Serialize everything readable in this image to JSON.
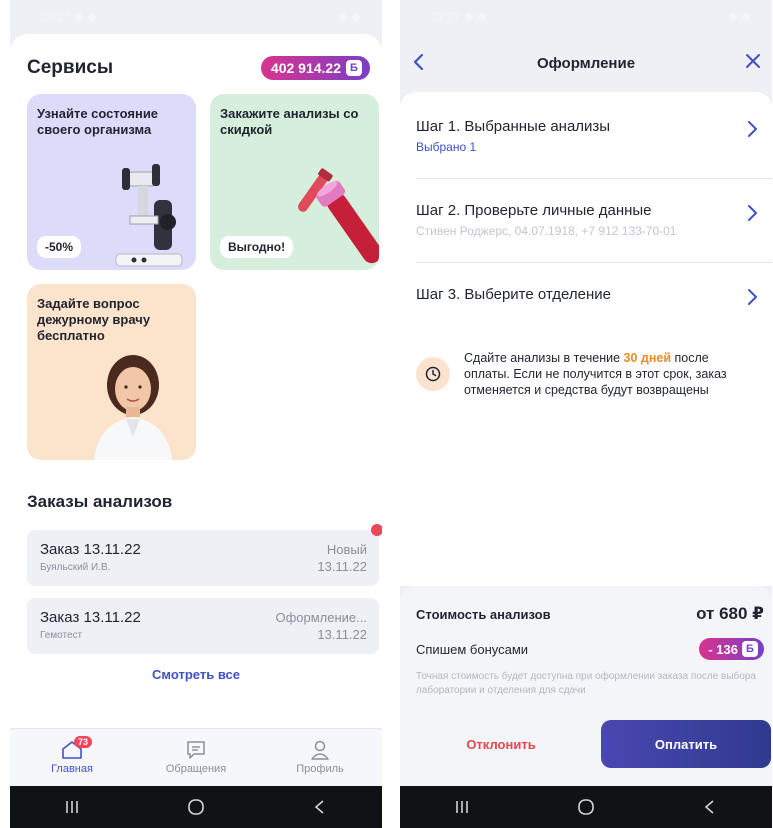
{
  "left": {
    "status": {
      "time": "23:27"
    },
    "services": {
      "title": "Сервисы",
      "bonus_balance": "402 914.22",
      "bonus_symbol": "Б"
    },
    "cards": [
      {
        "title": "Узнайте состояние своего организма",
        "badge": "-50%"
      },
      {
        "title": "Закажите анализы со скидкой",
        "badge": "Выгодно!"
      },
      {
        "title": "Задайте вопрос дежурному врачу бесплатно"
      }
    ],
    "orders": {
      "title": "Заказы анализов",
      "items": [
        {
          "name": "Заказ 13.11.22",
          "sub": "Буяльский И.В.",
          "status": "Новый",
          "date": "13.11.22"
        },
        {
          "name": "Заказ 13.11.22",
          "sub": "Гемотест",
          "status": "Оформление...",
          "date": "13.11.22"
        }
      ],
      "see_all": "Смотреть все"
    },
    "tabs": [
      {
        "label": "Главная",
        "count": "73"
      },
      {
        "label": "Обращения"
      },
      {
        "label": "Профиль"
      }
    ]
  },
  "right": {
    "status": {
      "time": "23:27"
    },
    "header": {
      "title": "Оформление"
    },
    "steps": [
      {
        "title": "Шаг 1. Выбранные анализы",
        "sub": "Выбрано 1"
      },
      {
        "title": "Шаг 2. Проверьте личные данные",
        "sub": "Стивен Роджерс, 04.07.1918, +7 912 133-70-01"
      },
      {
        "title": "Шаг 3. Выберите отделение"
      }
    ],
    "info": {
      "before": "Сдайте анализы в течение ",
      "highlight": "30 дней",
      "after": " после оплаты. Если не получится в этот срок, заказ отменяется и средства будут возвращены"
    },
    "price": {
      "cost_label": "Стоимость анализов",
      "cost_value": "от 680 ₽",
      "bonus_label": "Спишем бонусами",
      "bonus_value": "- 136",
      "bonus_symbol": "Б",
      "note": "Точная стоимость будет доступна при оформлении заказа после выбора лаборатории и отделения для сдачи"
    },
    "buttons": {
      "decline": "Отклонить",
      "pay": "Оплатить"
    }
  },
  "colors": {
    "accent": "#3f51c7",
    "bonus_gradient_start": "#d8348f",
    "bonus_gradient_end": "#7b3fc4",
    "danger": "#e5474c",
    "highlight": "#ef8a2a"
  },
  "icons": [
    "home-icon",
    "chat-icon",
    "profile-icon",
    "clock-icon",
    "chevron-right-icon",
    "back-arrow-icon",
    "close-icon",
    "microscope-icon",
    "test-tube-icon",
    "doctor-avatar"
  ]
}
